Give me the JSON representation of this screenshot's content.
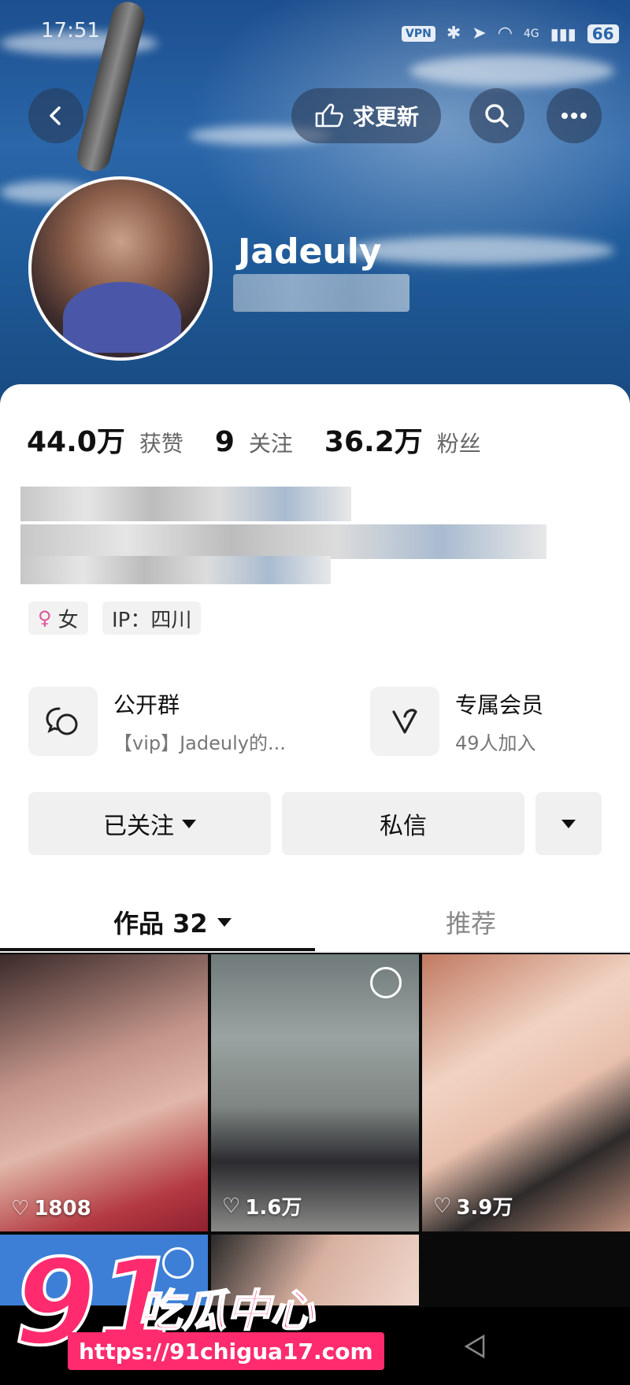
{
  "status_bar": {
    "time": "17:51",
    "vpn": "VPN",
    "network": "4G",
    "battery": "66"
  },
  "top_bar": {
    "request_update_label": "求更新"
  },
  "profile": {
    "username": "Jadeuly"
  },
  "stats": [
    {
      "value": "44.0万",
      "label": "获赞"
    },
    {
      "value": "9",
      "label": "关注"
    },
    {
      "value": "36.2万",
      "label": "粉丝"
    }
  ],
  "tags": {
    "gender": "女",
    "ip": "IP：四川"
  },
  "features": {
    "group": {
      "title": "公开群",
      "subtitle": "【vip】Jadeuly的..."
    },
    "membership": {
      "title": "专属会员",
      "subtitle": "49人加入"
    }
  },
  "actions": {
    "followed_label": "已关注",
    "message_label": "私信"
  },
  "tabs": {
    "works_label": "作品 32",
    "recommend_label": "推荐"
  },
  "grid": [
    {
      "likes": "1808"
    },
    {
      "likes": "1.6万"
    },
    {
      "likes": "3.9万"
    }
  ],
  "watermark": {
    "number": "91",
    "text": "吃瓜中心",
    "url": "https://91chigua17.com"
  },
  "colors": {
    "accent": "#ff2b6e",
    "header_blue": "#2a66a9"
  }
}
